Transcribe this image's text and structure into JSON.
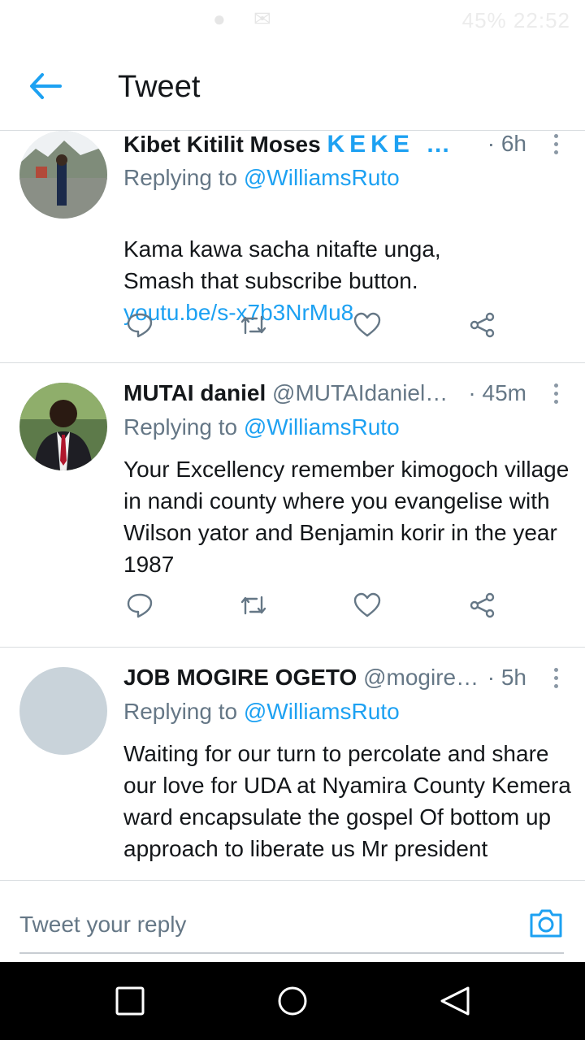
{
  "status_bar": {
    "battery": "45%",
    "time": "22:52"
  },
  "header": {
    "title": "Tweet",
    "back_icon": "arrow-left-icon"
  },
  "tweets": [
    {
      "name": "Kibet Kitilit Moses",
      "name_suffix": "KEKE …",
      "handle": "",
      "time": "· 6h",
      "reply_prefix": "Replying to ",
      "reply_mention": "@WilliamsRuto",
      "text": "Kama kawa sacha nitafte unga,\nSmash that subscribe button.",
      "link": "youtu.be/s-x7b3NrMu8"
    },
    {
      "name": "MUTAI daniel",
      "handle": "@MUTAIdaniel…",
      "time": "· 45m",
      "reply_prefix": "Replying to ",
      "reply_mention": "@WilliamsRuto",
      "text": "Your Excellency remember kimogoch village in nandi county where you evangelise with Wilson yator and Benjamin korir in the year 1987"
    },
    {
      "name": "JOB MOGIRE OGETO",
      "handle": "@mogire…",
      "time": "· 5h",
      "reply_prefix": "Replying to ",
      "reply_mention": "@WilliamsRuto",
      "text": "Waiting for our turn to percolate and share our love for UDA at Nyamira County Kemera ward encapsulate the gospel Of bottom up approach to liberate us Mr president"
    }
  ],
  "reply_bar": {
    "placeholder": "Tweet your reply",
    "camera_icon": "camera-icon"
  },
  "nav_bar": {
    "icons": [
      "recents-square-icon",
      "home-circle-icon",
      "back-triangle-icon"
    ]
  },
  "colors": {
    "accent": "#1da1f2",
    "secondary_text": "#657786",
    "divider": "#d9dde0"
  }
}
